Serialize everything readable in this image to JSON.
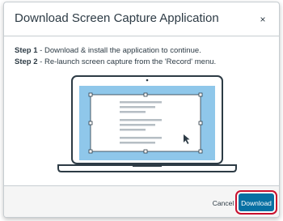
{
  "dialog": {
    "title": "Download Screen Capture Application",
    "close_label": "×"
  },
  "steps": [
    {
      "label": "Step 1",
      "text": " - Download & install the application to continue."
    },
    {
      "label": "Step 2",
      "text": " - Re-launch screen capture from the 'Record' menu."
    }
  ],
  "footer": {
    "cancel_label": "Cancel",
    "download_label": "Download"
  },
  "colors": {
    "accent": "#0770a3",
    "screen": "#8fc7ea",
    "highlight_ring": "#c8102e"
  }
}
